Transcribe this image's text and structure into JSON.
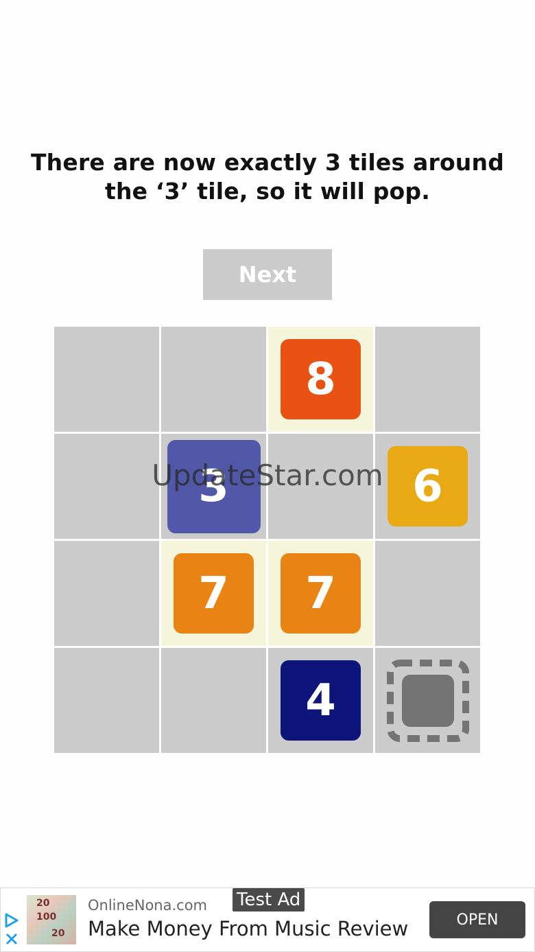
{
  "instruction": {
    "line1": "There are now exactly 3 tiles around",
    "line2": "the ‘3’ tile, so it will pop."
  },
  "next_button": {
    "label": "Next"
  },
  "board": {
    "rows": 4,
    "cols": 4,
    "highlighted_cells": [
      [
        0,
        2
      ],
      [
        2,
        1
      ],
      [
        2,
        2
      ]
    ],
    "tiles": [
      {
        "row": 0,
        "col": 2,
        "value": "8",
        "color": "#e85314",
        "style": "normal"
      },
      {
        "row": 1,
        "col": 1,
        "value": "3",
        "color": "#5158a8",
        "style": "enlarged"
      },
      {
        "row": 1,
        "col": 3,
        "value": "6",
        "color": "#e8a914",
        "style": "normal"
      },
      {
        "row": 2,
        "col": 1,
        "value": "7",
        "color": "#e88314",
        "style": "normal"
      },
      {
        "row": 2,
        "col": 2,
        "value": "7",
        "color": "#e88314",
        "style": "normal"
      },
      {
        "row": 3,
        "col": 2,
        "value": "4",
        "color": "#0d157a",
        "style": "normal"
      }
    ],
    "next_tile_slot": {
      "row": 3,
      "col": 3,
      "color": "#747474",
      "icon": "dashed-square-icon"
    }
  },
  "watermark": "UpdateStar.com",
  "ad": {
    "badge": "Test Ad",
    "source": "OnlineNona.com",
    "headline": "Make Money From Music Review",
    "cta": "OPEN",
    "thumb_labels": [
      "20",
      "100",
      "20"
    ]
  },
  "colors": {
    "cell": "#cbcbcb",
    "cell_highlight": "#f5f5dc",
    "button_bg": "#cbcbcb"
  }
}
